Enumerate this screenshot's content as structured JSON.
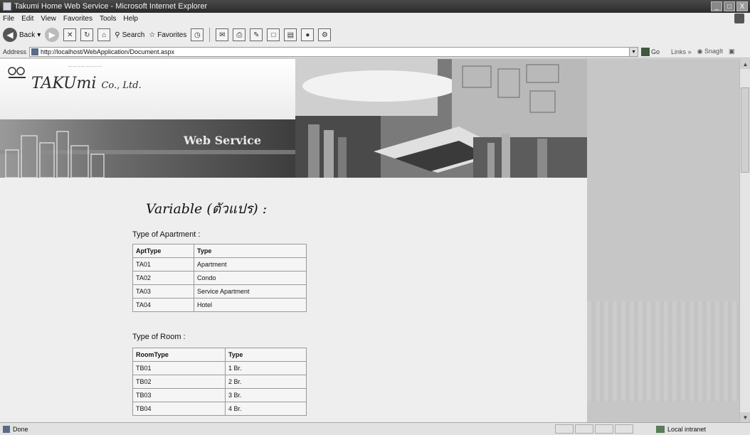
{
  "window": {
    "title": "Takumi Home Web Service - Microsoft Internet Explorer",
    "controls": [
      "_",
      "□",
      "X"
    ]
  },
  "menu": [
    "File",
    "Edit",
    "View",
    "Favorites",
    "Tools",
    "Help"
  ],
  "toolbar": {
    "back_label": "Back",
    "search_label": "Search",
    "favorites_label": "Favorites"
  },
  "address": {
    "label": "Address",
    "url": "http://localhost/WebApplication/Document.aspx",
    "go_label": "Go",
    "links_label": "Links",
    "snagit_label": "SnagIt"
  },
  "banner": {
    "logo_text": "TAKUmi",
    "logo_co": "Co., Ltd.",
    "heading": "Web Service"
  },
  "content": {
    "title": "Variable (ตัวแปร) :",
    "apartment_caption": "Type of Apartment :",
    "apartment_table": {
      "headers": [
        "AptType",
        "Type"
      ],
      "rows": [
        [
          "TA01",
          "Apartment"
        ],
        [
          "TA02",
          "Condo"
        ],
        [
          "TA03",
          "Service Apartment"
        ],
        [
          "TA04",
          "Hotel"
        ]
      ]
    },
    "room_caption": "Type of Room :",
    "room_table": {
      "headers": [
        "RoomType",
        "Type"
      ],
      "rows": [
        [
          "TB01",
          "1 Br."
        ],
        [
          "TB02",
          "2 Br."
        ],
        [
          "TB03",
          "3 Br."
        ],
        [
          "TB04",
          "4 Br."
        ]
      ]
    }
  },
  "status": {
    "left": "Done",
    "zone": "Local intranet"
  }
}
